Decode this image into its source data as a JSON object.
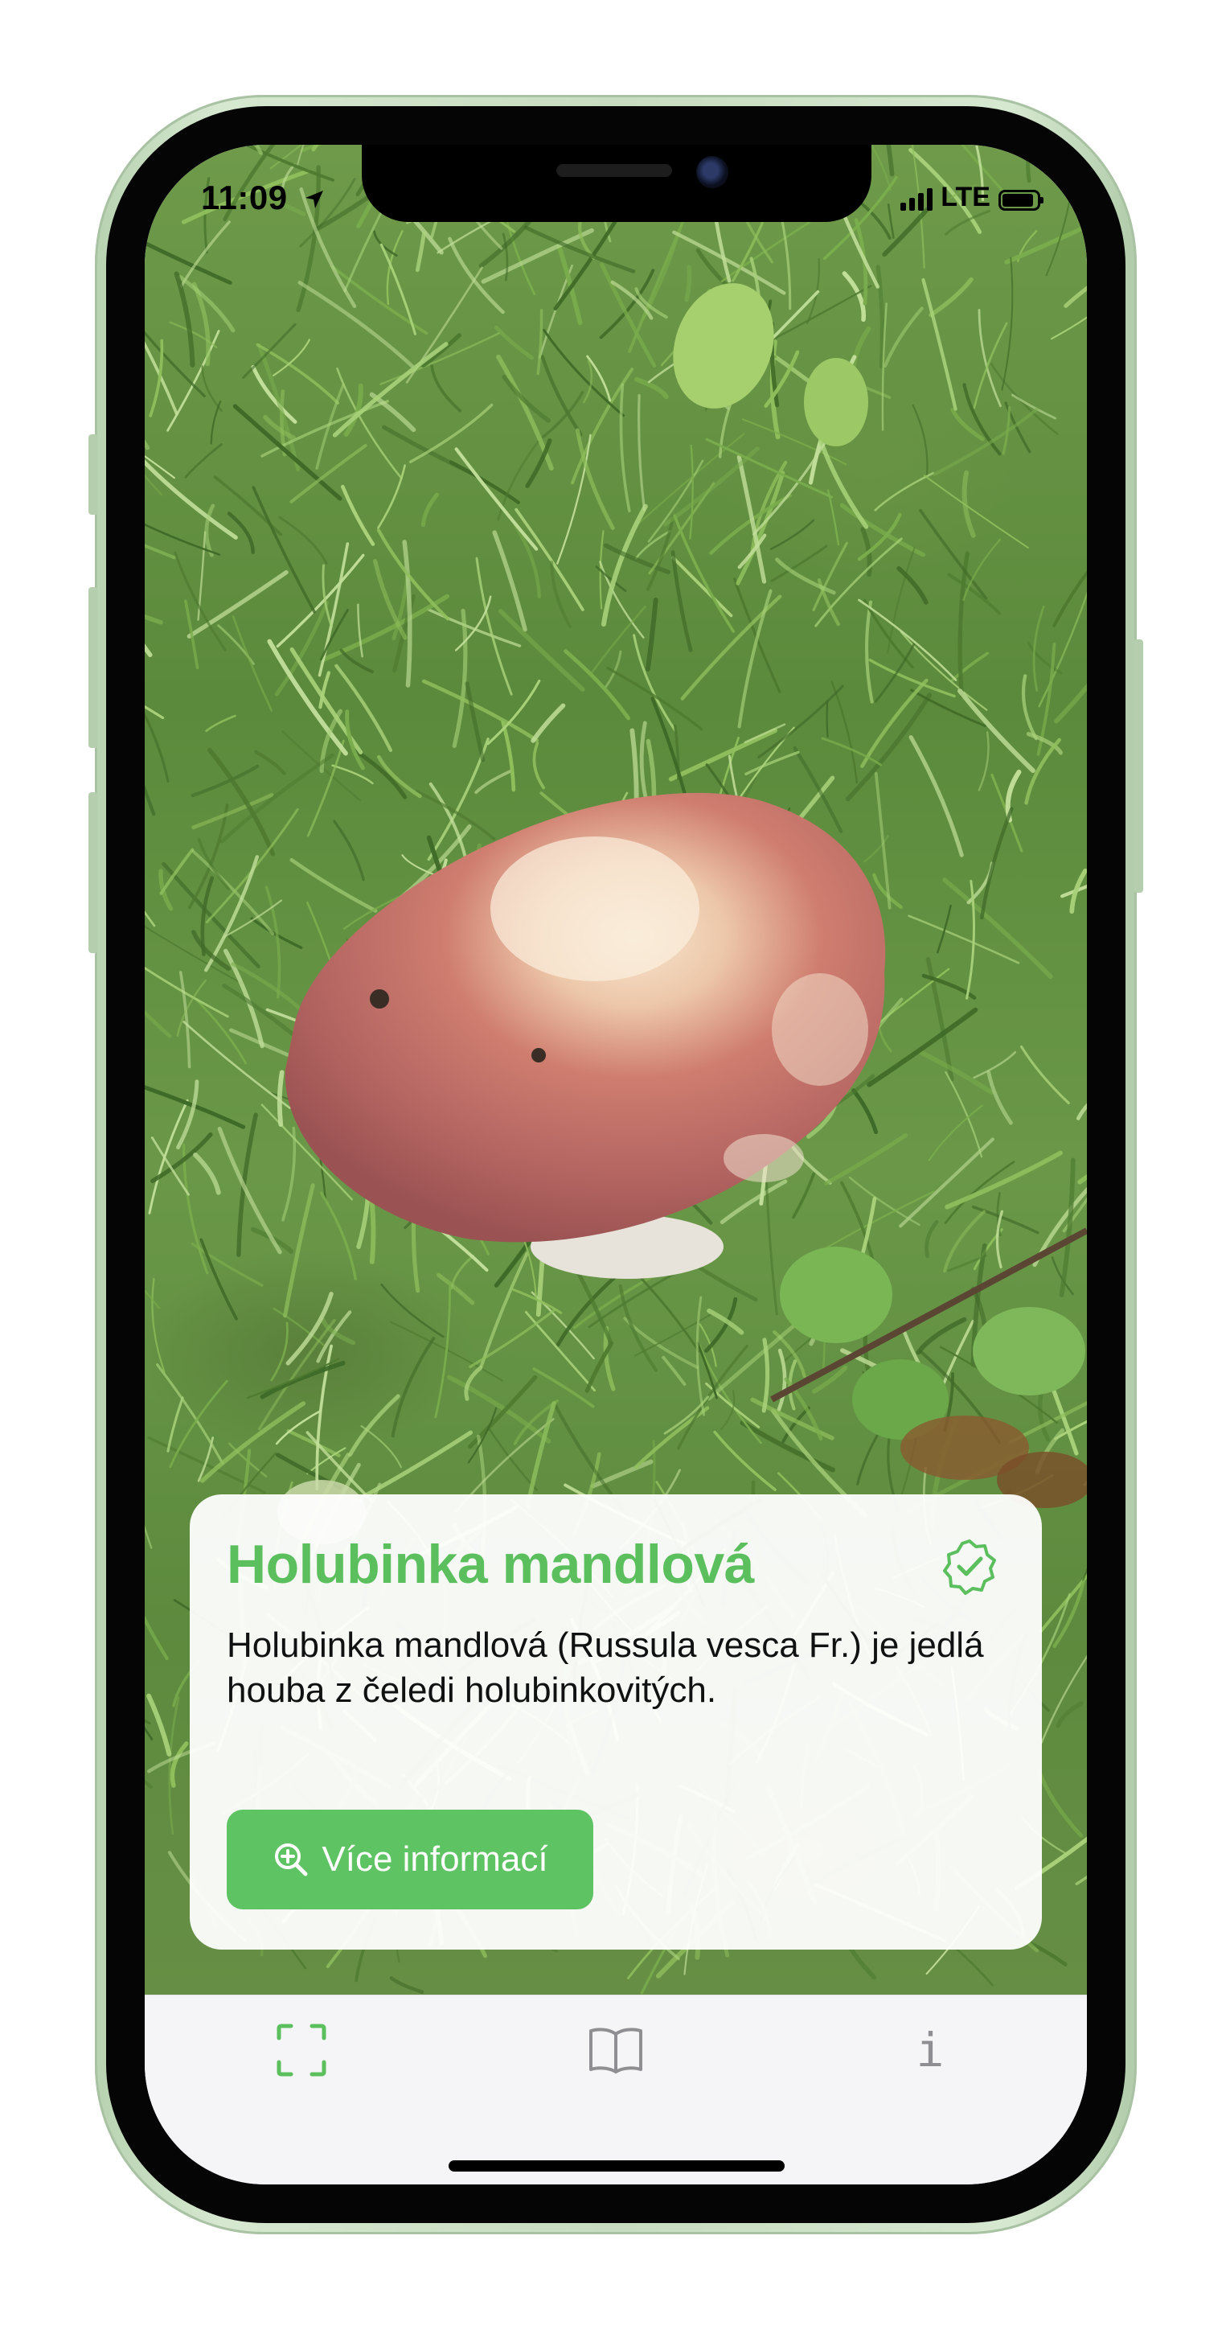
{
  "status_bar": {
    "time": "11:09",
    "network": "LTE",
    "icons": [
      "location-arrow-icon",
      "signal-bars-icon",
      "battery-icon"
    ]
  },
  "result_card": {
    "title": "Holubinka mandlová",
    "description": "Holubinka mandlová (Russula vesca Fr.) je jedlá houba z čeledi holubinkovitých.",
    "button_label": "Více informací",
    "button_icon": "zoom-in-icon",
    "badge_icon": "verified-check-icon"
  },
  "tab_bar": {
    "tabs": [
      {
        "name": "scan",
        "icon": "scan-frame-icon",
        "active": true
      },
      {
        "name": "atlas",
        "icon": "open-book-icon",
        "active": false
      },
      {
        "name": "info",
        "icon": "info-i-icon",
        "glyph": "i",
        "active": false
      }
    ]
  },
  "colors": {
    "accent": "#5bbf5e",
    "button": "#5ec362",
    "inactive_icon": "#8e8e93",
    "tab_bar_bg": "#f5f5f7"
  }
}
